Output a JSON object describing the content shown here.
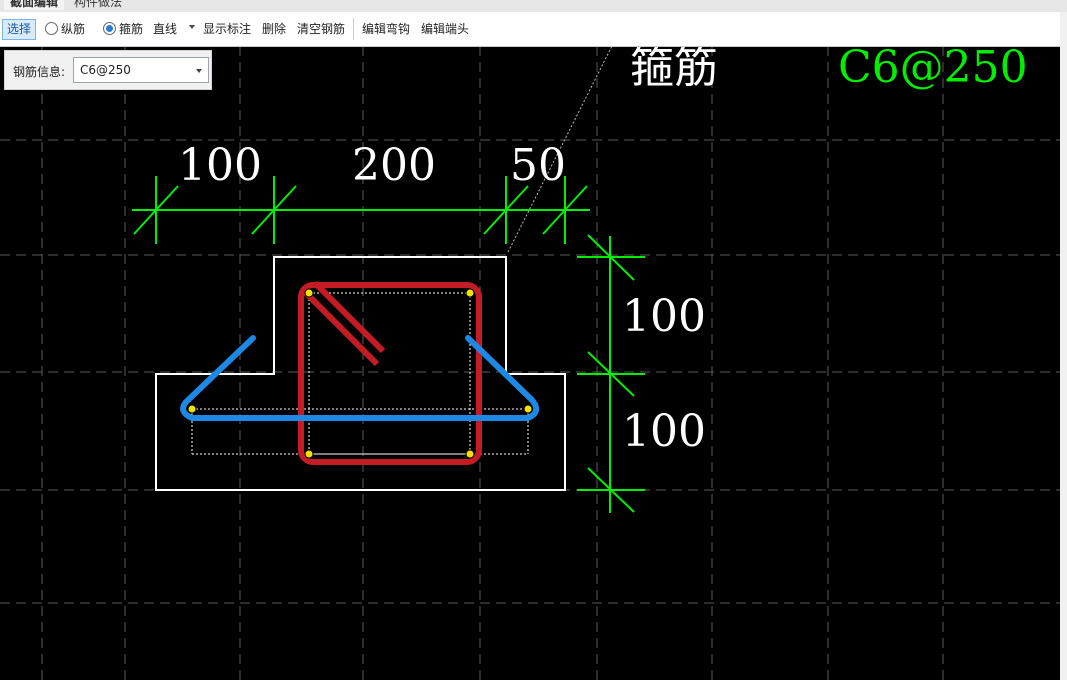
{
  "tabs": [
    {
      "label": "截面编辑",
      "active": true
    },
    {
      "label": "构件做法",
      "active": false
    }
  ],
  "toolbar": {
    "select": "选择",
    "longitudinal": "纵筋",
    "stirrup": "箍筋",
    "line_mode": "直线",
    "show_dims": "显示标注",
    "delete": "删除",
    "clear": "清空钢筋",
    "edit_hook": "编辑弯钩",
    "edit_end": "编辑端头",
    "selected_radio": "stirrup"
  },
  "rebar_info": {
    "label": "钢筋信息:",
    "value": "C6@250"
  },
  "drawing": {
    "rebar_type": "箍筋",
    "rebar_spec": "C6@250",
    "dims_horizontal": [
      "100",
      "200",
      "50"
    ],
    "dims_vertical": [
      "100",
      "100"
    ]
  },
  "colors": {
    "background": "#000000",
    "dimension": "#00ee00",
    "stirrup_red": "#c41c24",
    "tie_blue": "#1e88e5",
    "outline": "#ffffff",
    "bar_dot": "#f2e200"
  }
}
